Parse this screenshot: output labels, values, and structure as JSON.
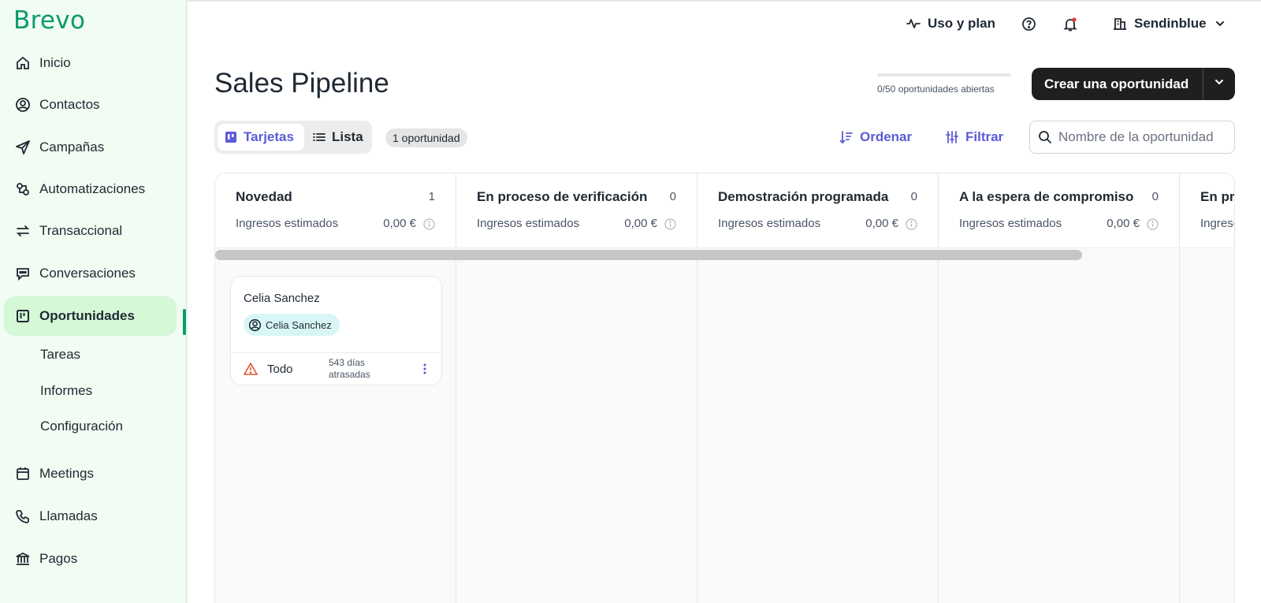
{
  "app": {
    "logo": "Brevo"
  },
  "sidebar": {
    "items": [
      {
        "label": "Inicio",
        "icon": "home-icon"
      },
      {
        "label": "Contactos",
        "icon": "user-circle-icon"
      },
      {
        "label": "Campañas",
        "icon": "send-icon"
      },
      {
        "label": "Automatizaciones",
        "icon": "automation-icon"
      },
      {
        "label": "Transaccional",
        "icon": "repeat-icon"
      },
      {
        "label": "Conversaciones",
        "icon": "chat-icon"
      },
      {
        "label": "Oportunidades",
        "icon": "kanban-icon",
        "active": true
      },
      {
        "label": "Meetings",
        "icon": "calendar-icon"
      },
      {
        "label": "Llamadas",
        "icon": "phone-icon"
      },
      {
        "label": "Pagos",
        "icon": "bank-icon"
      }
    ],
    "subitems": [
      "Tareas",
      "Informes",
      "Configuración"
    ]
  },
  "topbar": {
    "usage_label": "Uso y plan",
    "account_label": "Sendinblue"
  },
  "header": {
    "title": "Sales Pipeline",
    "progress": {
      "label": "0/50 oportunidades abiertas",
      "value": 0,
      "max": 50
    },
    "create_button": "Crear una oportunidad"
  },
  "toolbar": {
    "view_cards": "Tarjetas",
    "view_list": "Lista",
    "count_badge": "1 oportunidad",
    "sort_label": "Ordenar",
    "filter_label": "Filtrar",
    "search_placeholder": "Nombre de la oportunidad"
  },
  "board": {
    "columns": [
      {
        "title": "Novedad",
        "count": "1",
        "revenue_label": "Ingresos estimados",
        "revenue": "0,00 €"
      },
      {
        "title": "En proceso de verificación",
        "count": "0",
        "revenue_label": "Ingresos estimados",
        "revenue": "0,00 €"
      },
      {
        "title": "Demostración programada",
        "count": "0",
        "revenue_label": "Ingresos estimados",
        "revenue": "0,00 €"
      },
      {
        "title": "A la espera de compromiso",
        "count": "0",
        "revenue_label": "Ingresos estimados",
        "revenue": "0,00 €"
      },
      {
        "title": "En pro",
        "count": "",
        "revenue_label": "Ingreso",
        "revenue": ""
      }
    ],
    "card": {
      "title": "Celia Sanchez",
      "contact": "Celia Sanchez",
      "task": "Todo",
      "overdue": "543 días atrasadas"
    }
  },
  "colors": {
    "brand": "#0b996e",
    "accent": "#5b5bd6",
    "sidebar_bg": "#f1fcf2",
    "active_bg": "#d5f8d6",
    "warning": "#e0522f",
    "notification_dot": "#e53935"
  }
}
